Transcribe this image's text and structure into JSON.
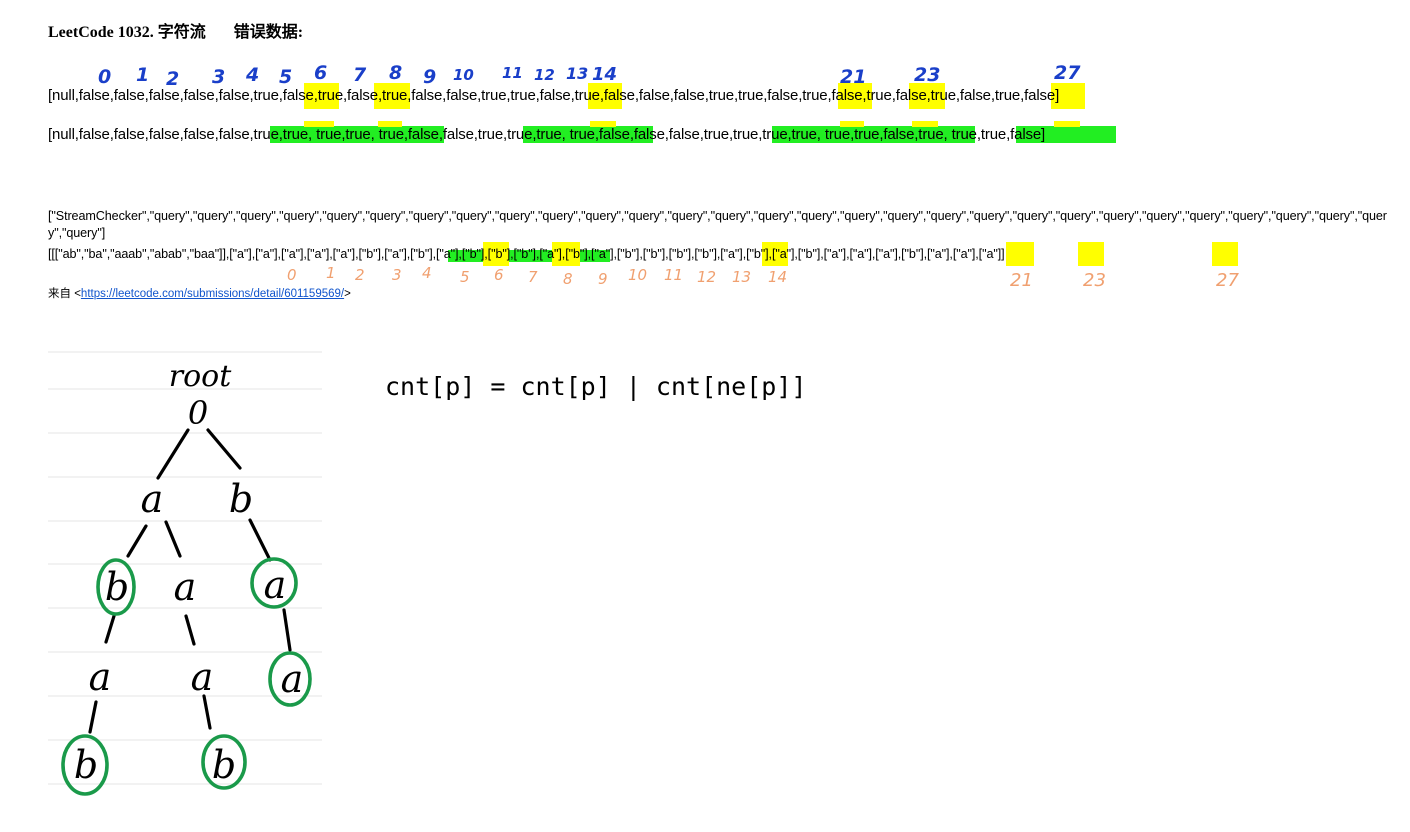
{
  "title": {
    "problem": "LeetCode 1032. 字符流",
    "label": "错误数据:"
  },
  "annotations_top": [
    "0",
    "1",
    "2",
    "3",
    "4",
    "5",
    "6",
    "7",
    "8",
    "9",
    "10",
    "11",
    "12",
    "13",
    "14",
    "21",
    "23",
    "27"
  ],
  "result_line_1": "[null,false,false,false,false,false,true,false,true,false,true,false,false,true,true,false,true,false,false,false,true,true,false,true,false,true,false,true,false,true,false]",
  "result_line_2": "[null,false,false,false,false,false,true,true, true,true, true,false,false,true,true,true, true,false,false,false,true,true,true,true, true,true,false,true, true,true,false]",
  "input_ops": "[\"StreamChecker\",\"query\",\"query\",\"query\",\"query\",\"query\",\"query\",\"query\",\"query\",\"query\",\"query\",\"query\",\"query\",\"query\",\"query\",\"query\",\"query\",\"query\",\"query\",\"query\",\"query\",\"query\",\"query\",\"query\",\"query\",\"query\",\"query\",\"query\",\"query\",\"query\",\"query\"]",
  "input_args": "[[[\"ab\",\"ba\",\"aaab\",\"abab\",\"baa\"]],[\"a\"],[\"a\"],[\"a\"],[\"a\"],[\"a\"],[\"b\"],[\"a\"],[\"b\"],[\"a\"],[\"b\"],[\"b\"],[\"b\"],[\"a\"],[\"b\"],[\"a\"],[\"b\"],[\"b\"],[\"b\"],[\"b\"],[\"a\"],[\"b\"],[\"a\"],[\"b\"],[\"a\"],[\"a\"],[\"a\"],[\"b\"],[\"a\"],[\"a\"],[\"a\"]]",
  "annotations_bottom": [
    "0",
    "1",
    "2",
    "3",
    "4",
    "5",
    "6",
    "7",
    "8",
    "9",
    "10",
    "11",
    "12",
    "13",
    "14",
    "21",
    "23",
    "27"
  ],
  "source": {
    "prefix": "来自 <",
    "url": "https://leetcode.com/submissions/detail/601159569/",
    "suffix": ">"
  },
  "trie": {
    "root_label": "root",
    "root_node": "0",
    "nodes": [
      "a",
      "b",
      "b",
      "a",
      "a",
      "a",
      "a",
      "a",
      "b",
      "b"
    ]
  },
  "formula": "cnt[p] = cnt[p] | cnt[ne[p]]",
  "colors": {
    "highlight_yellow": "#ffff00",
    "highlight_green": "#22ee22",
    "circle_green": "#1a9a4a",
    "blue_ink": "#1a3fc9",
    "orange_ink": "#f0a070"
  }
}
